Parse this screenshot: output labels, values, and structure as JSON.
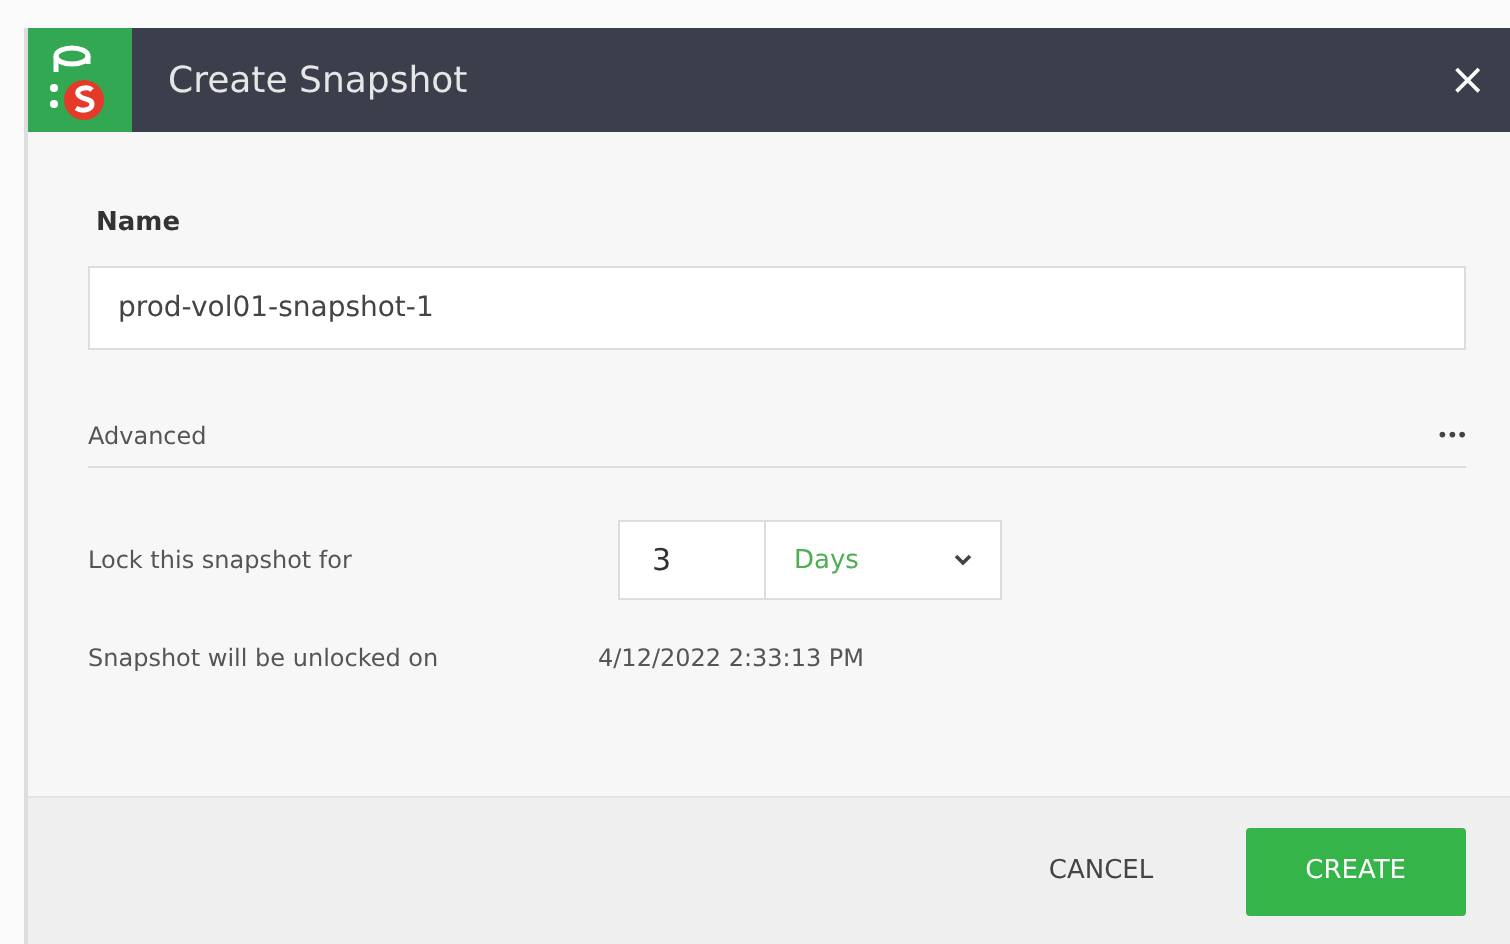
{
  "window": {
    "title": "Create Snapshot",
    "close": "×"
  },
  "name": {
    "label": "Name",
    "value": "prod-vol01-snapshot-1"
  },
  "advanced": {
    "label": "Advanced",
    "menu": "•••"
  },
  "lock": {
    "label": "Lock this snapshot for",
    "amount": "3",
    "unit": "Days"
  },
  "unlock": {
    "label": "Snapshot will be unlocked on",
    "value": "4/12/2022 2:33:13 PM"
  },
  "buttons": [
    {
      "label": "CANCEL",
      "kind": "secondary"
    },
    {
      "label": "CREATE",
      "kind": "primary"
    }
  ]
}
